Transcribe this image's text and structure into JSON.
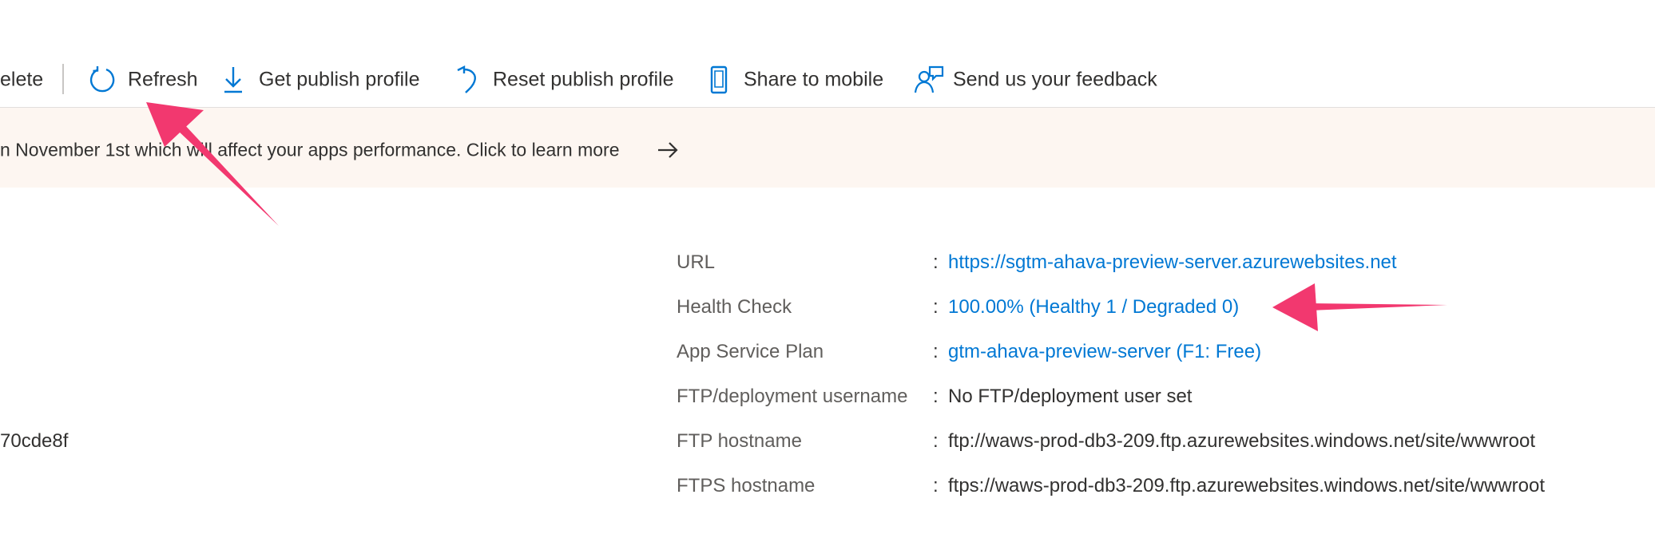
{
  "toolbar": {
    "delete_fragment": "elete",
    "refresh_label": "Refresh",
    "get_publish_profile_label": "Get publish profile",
    "reset_publish_profile_label": "Reset publish profile",
    "share_to_mobile_label": "Share to mobile",
    "feedback_label": "Send us your feedback"
  },
  "banner": {
    "text": "n November 1st which will affect your apps performance. Click to learn more"
  },
  "left_column": {
    "id_fragment": "70cde8f"
  },
  "properties": [
    {
      "label": "URL",
      "value": "https://sgtm-ahava-preview-server.azurewebsites.net"
    },
    {
      "label": "Health Check",
      "value": "100.00% (Healthy 1 / Degraded 0)"
    },
    {
      "label": "App Service Plan",
      "value": "gtm-ahava-preview-server (F1: Free)"
    },
    {
      "label": "FTP/deployment username",
      "value": "No FTP/deployment user set"
    },
    {
      "label": "FTP hostname",
      "value": "ftp://waws-prod-db3-209.ftp.azurewebsites.windows.net/site/wwwroot"
    },
    {
      "label": "FTPS hostname",
      "value": "ftps://waws-prod-db3-209.ftp.azurewebsites.windows.net/site/wwwroot"
    }
  ],
  "separator": ":",
  "colors": {
    "link": "#0078d4",
    "banner_bg": "#fdf6f1",
    "annotation_arrow": "#f2386f"
  },
  "icons": [
    "refresh-icon",
    "download-icon",
    "reset-icon",
    "mobile-icon",
    "feedback-icon",
    "arrow-right-icon"
  ]
}
